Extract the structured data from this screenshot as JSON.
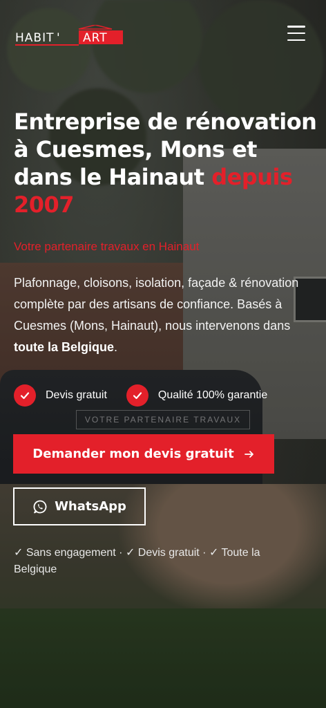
{
  "header": {
    "logo_text_left": "HABIT",
    "logo_text_right": "ART",
    "menu_icon": "hamburger-menu-icon"
  },
  "hero": {
    "title_main": "Entreprise de rénovation à Cuesmes, Mons et dans le Hainaut ",
    "title_accent": "depuis 2007",
    "tagline": "Votre partenaire travaux en Hainaut",
    "desc_start": "Plafonnage, cloisons, isolation, façade & rénovation complète par des artisans de confiance. Basés à Cuesmes (Mons, Hainaut), nous intervenons dans ",
    "desc_bold": "toute la Belgique",
    "desc_end": "."
  },
  "badges": [
    {
      "label": "Devis gratuit",
      "icon": "check-icon"
    },
    {
      "label": "Qualité 100% garantie",
      "icon": "check-icon"
    }
  ],
  "buttons": {
    "cta_label": "Demander mon devis gratuit",
    "cta_icon": "arrow-right-icon",
    "whatsapp_label": "WhatsApp",
    "whatsapp_icon": "whatsapp-icon"
  },
  "footnote": "✓ Sans engagement · ✓ Devis gratuit · ✓ Toute la Belgique",
  "background": {
    "van_text": "VOTRE PARTENAIRE TRAVAUX"
  },
  "colors": {
    "accent": "#e3202a",
    "text": "#ffffff"
  }
}
